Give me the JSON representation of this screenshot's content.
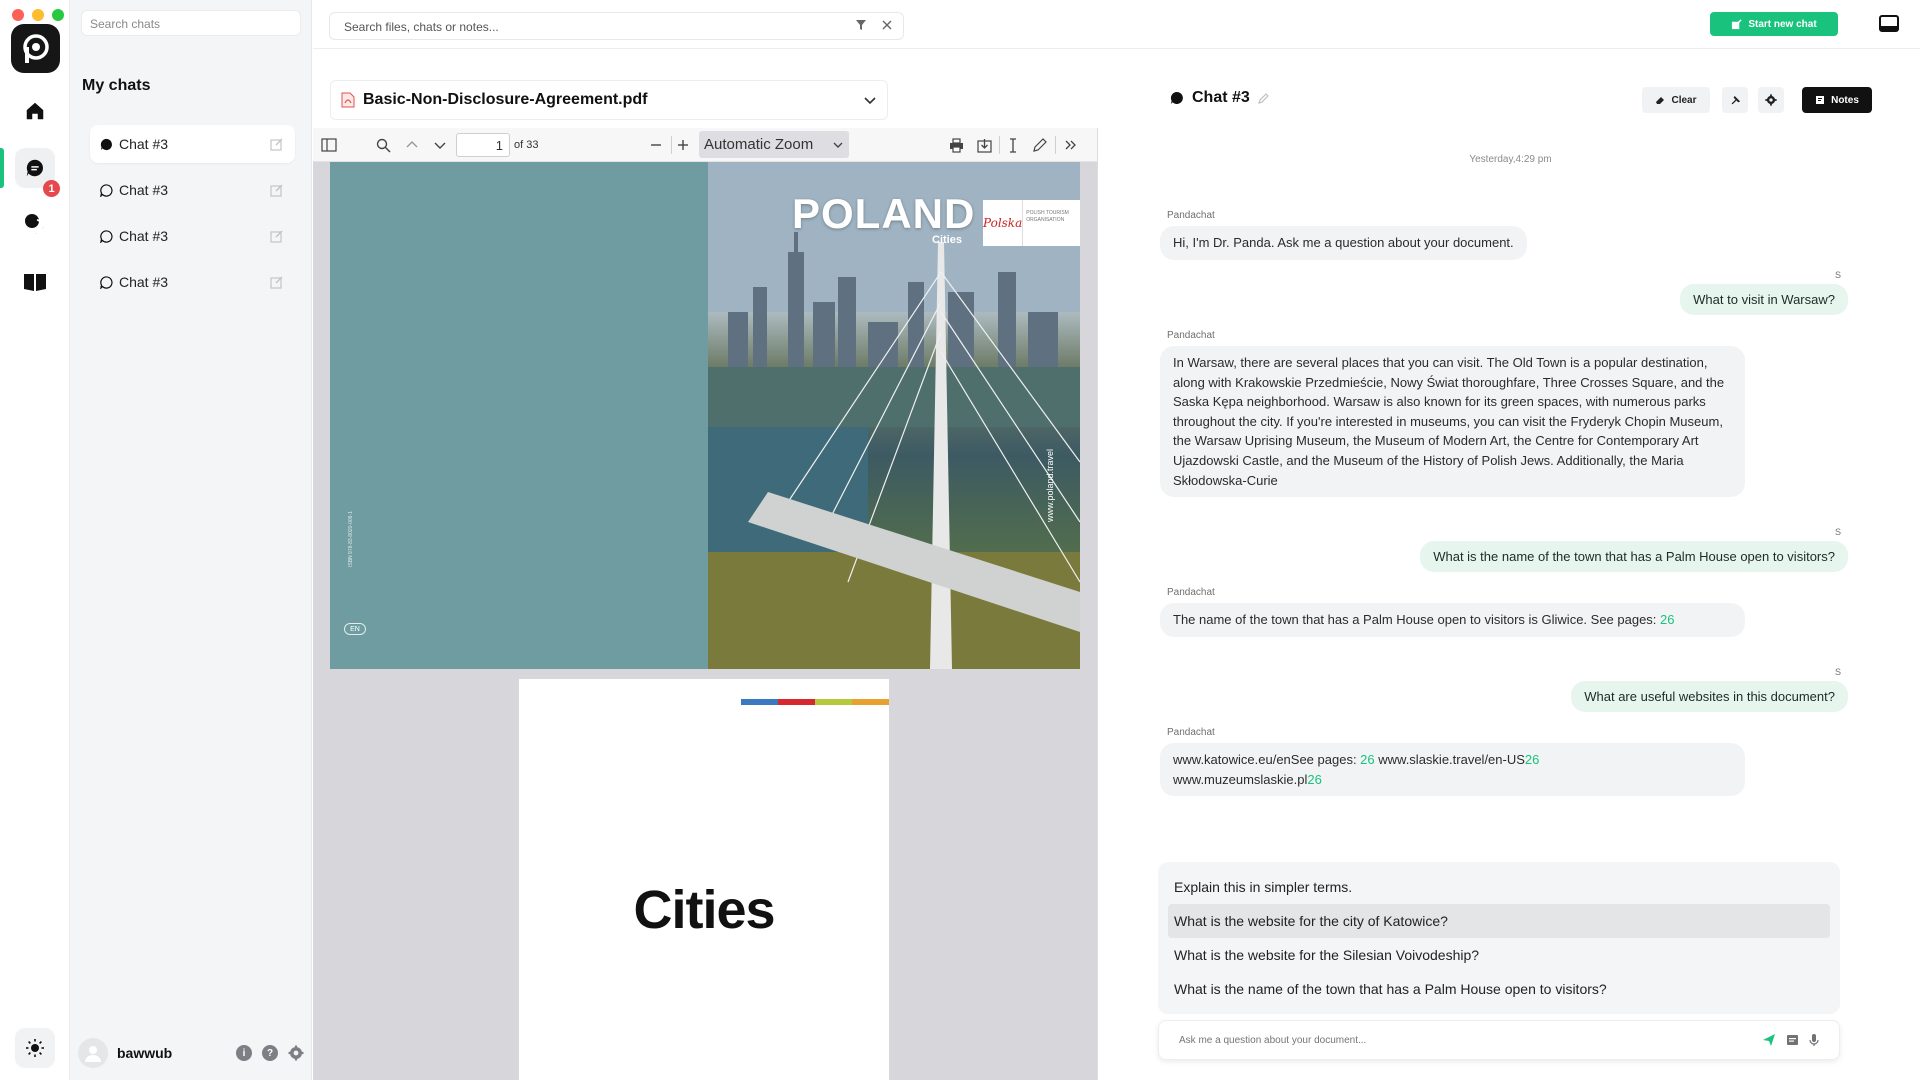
{
  "sidebar": {
    "search_placeholder": "Search chats",
    "title": "My chats",
    "chats": [
      {
        "label": "Chat #3",
        "active": true
      },
      {
        "label": "Chat #3",
        "active": false
      },
      {
        "label": "Chat #3",
        "active": false
      },
      {
        "label": "Chat #3",
        "active": false
      }
    ],
    "user": {
      "name": "bawwub"
    }
  },
  "rail": {
    "badge_count": "1",
    "icons": [
      "home-icon",
      "chat-icon",
      "chats-stack-icon",
      "book-icon",
      "sun-icon"
    ]
  },
  "topbar": {
    "search_placeholder": "Search files, chats or notes...",
    "start_chat_label": "Start new chat"
  },
  "document": {
    "title": "Basic-Non-Disclosure-Agreement.pdf",
    "toolbar": {
      "page_number": "1",
      "page_total": "of 33",
      "zoom": "Automatic Zoom"
    },
    "cover": {
      "title": "POLAND",
      "subtitle": "Cities",
      "logo_text": "Polska",
      "org_text": "POLISH TOURISM ORGANISATION",
      "url": "www.poland.travel",
      "isbn": "ISBN 978-83-8020-009-1",
      "lang": "EN"
    },
    "page2": {
      "heading": "Cities"
    }
  },
  "chat": {
    "title": "Chat #3",
    "clear_label": "Clear",
    "notes_label": "Notes",
    "timestamp": "Yesterday,4:29 pm",
    "bot_name": "Pandachat",
    "user_initial": "S",
    "messages": {
      "m1": "Hi, I'm Dr. Panda. Ask me a question about your document.",
      "m2": "What to visit in Warsaw?",
      "m3": "In Warsaw, there are several places that you can visit. The Old Town is a popular destination, along with Krakowskie Przedmieście, Nowy Świat thoroughfare, Three Crosses Square, and the Saska Kępa neighborhood. Warsaw is also known for its green spaces, with numerous parks throughout the city. If you're interested in museums, you can visit the Fryderyk Chopin Museum, the Warsaw Uprising Museum, the Museum of Modern Art, the Centre for Contemporary Art Ujazdowski Castle, and the Museum of the History of Polish Jews. Additionally, the Maria Skłodowska-Curie",
      "m4": "What is the name of the town that has a Palm House open to visitors?",
      "m5_text": "The name of the town that has a Palm House open to visitors is Gliwice. See pages:",
      "m5_page": "26",
      "m6": "What are useful websites in this document?",
      "m7_a": "www.katowice.eu/enSee pages: ",
      "m7_a_page": "26",
      "m7_b": " www.slaskie.travel/en-US",
      "m7_b_page": "26",
      "m7_c": "www.muzeumslaskie.pl",
      "m7_c_page": "26"
    },
    "suggestions": [
      "Explain this in simpler terms.",
      "What is the website for the city of Katowice?",
      "What is the website for the Silesian Voivodeship?",
      "What is the name of the town that has a Palm House open to visitors?"
    ],
    "composer_placeholder": "Ask me a question about your document..."
  },
  "colors": {
    "accent": "#19c37d",
    "badge": "#e5484d",
    "cover_teal": "#6e9ca0",
    "dark": "#111111"
  }
}
